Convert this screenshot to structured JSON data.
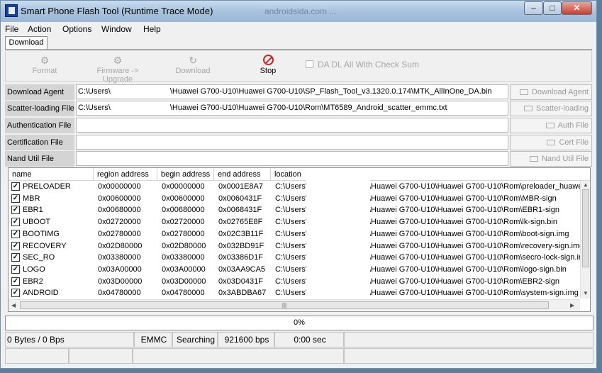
{
  "window": {
    "title": "Smart Phone Flash Tool (Runtime Trace Mode)",
    "title_ghost": "androidsida.com ...",
    "controls": {
      "minimize": "–",
      "maximize": "□",
      "close": "✕"
    }
  },
  "menu": [
    "File",
    "Action",
    "Options",
    "Window",
    "Help"
  ],
  "tab": "Download",
  "toolbar": {
    "format": "Format",
    "firmware_upgrade": "Firmware -> Upgrade",
    "download": "Download",
    "stop": "Stop",
    "checksum": "DA DL All With Check Sum"
  },
  "files": [
    {
      "label": "Download Agent",
      "value_a": "C:\\Users\\",
      "value_b": "\\Huawei G700-U10\\Huawei G700-U10\\SP_Flash_Tool_v3.1320.0.174\\MTK_AllInOne_DA.bin",
      "button": "Download Agent"
    },
    {
      "label": "Scatter-loading File",
      "value_a": "C:\\Users\\",
      "value_b": "\\Huawei G700-U10\\Huawei G700-U10\\Rom\\MT6589_Android_scatter_emmc.txt",
      "button": "Scatter-loading"
    },
    {
      "label": "Authentication File",
      "value_a": "",
      "value_b": "",
      "button": "Auth File"
    },
    {
      "label": "Certification File",
      "value_a": "",
      "value_b": "",
      "button": "Cert File"
    },
    {
      "label": "Nand Util File",
      "value_a": "",
      "value_b": "",
      "button": "Nand Util File"
    }
  ],
  "table": {
    "headers": [
      "name",
      "region address",
      "begin address",
      "end address",
      "location"
    ],
    "rows": [
      {
        "name": "PRELOADER",
        "region": "0x00000000",
        "begin": "0x00000000",
        "end": "0x0001E8A7",
        "loc_a": "C:\\Users'",
        "loc_b": "\\Huawei G700-U10\\Huawei G700-U10\\Rom\\preloader_huawe"
      },
      {
        "name": "MBR",
        "region": "0x00600000",
        "begin": "0x00600000",
        "end": "0x0060431F",
        "loc_a": "C:\\Users'",
        "loc_b": "\\Huawei G700-U10\\Huawei G700-U10\\Rom\\MBR-sign"
      },
      {
        "name": "EBR1",
        "region": "0x00680000",
        "begin": "0x00680000",
        "end": "0x0068431F",
        "loc_a": "C:\\Users'",
        "loc_b": "\\Huawei G700-U10\\Huawei G700-U10\\Rom\\EBR1-sign"
      },
      {
        "name": "UBOOT",
        "region": "0x02720000",
        "begin": "0x02720000",
        "end": "0x02765E8F",
        "loc_a": "C:\\Users'",
        "loc_b": "\\Huawei G700-U10\\Huawei G700-U10\\Rom\\lk-sign.bin"
      },
      {
        "name": "BOOTIMG",
        "region": "0x02780000",
        "begin": "0x02780000",
        "end": "0x02C3B11F",
        "loc_a": "C:\\Users'",
        "loc_b": "\\Huawei G700-U10\\Huawei G700-U10\\Rom\\boot-sign.img"
      },
      {
        "name": "RECOVERY",
        "region": "0x02D80000",
        "begin": "0x02D80000",
        "end": "0x032BD91F",
        "loc_a": "C:\\Users'",
        "loc_b": "\\Huawei G700-U10\\Huawei G700-U10\\Rom\\recovery-sign.img"
      },
      {
        "name": "SEC_RO",
        "region": "0x03380000",
        "begin": "0x03380000",
        "end": "0x03386D1F",
        "loc_a": "C:\\Users'",
        "loc_b": "\\Huawei G700-U10\\Huawei G700-U10\\Rom\\secro-lock-sign.ir"
      },
      {
        "name": "LOGO",
        "region": "0x03A00000",
        "begin": "0x03A00000",
        "end": "0x03AA9CA5",
        "loc_a": "C:\\Users'",
        "loc_b": "\\Huawei G700-U10\\Huawei G700-U10\\Rom\\logo-sign.bin"
      },
      {
        "name": "EBR2",
        "region": "0x03D00000",
        "begin": "0x03D00000",
        "end": "0x03D0431F",
        "loc_a": "C:\\Users'",
        "loc_b": "\\Huawei G700-U10\\Huawei G700-U10\\Rom\\EBR2-sign"
      },
      {
        "name": "ANDROID",
        "region": "0x04780000",
        "begin": "0x04780000",
        "end": "0x3ABDBA67",
        "loc_a": "C:\\Users'",
        "loc_b": "\\Huawei G700-U10\\Huawei G700-U10\\Rom\\system-sign.img"
      }
    ]
  },
  "progress": {
    "label": "0%",
    "fraction": 0
  },
  "status": {
    "bytes": "0 Bytes / 0 Bps",
    "storage": "EMMC",
    "state": "Searching",
    "baud": "921600 bps",
    "time": "0:00 sec"
  }
}
